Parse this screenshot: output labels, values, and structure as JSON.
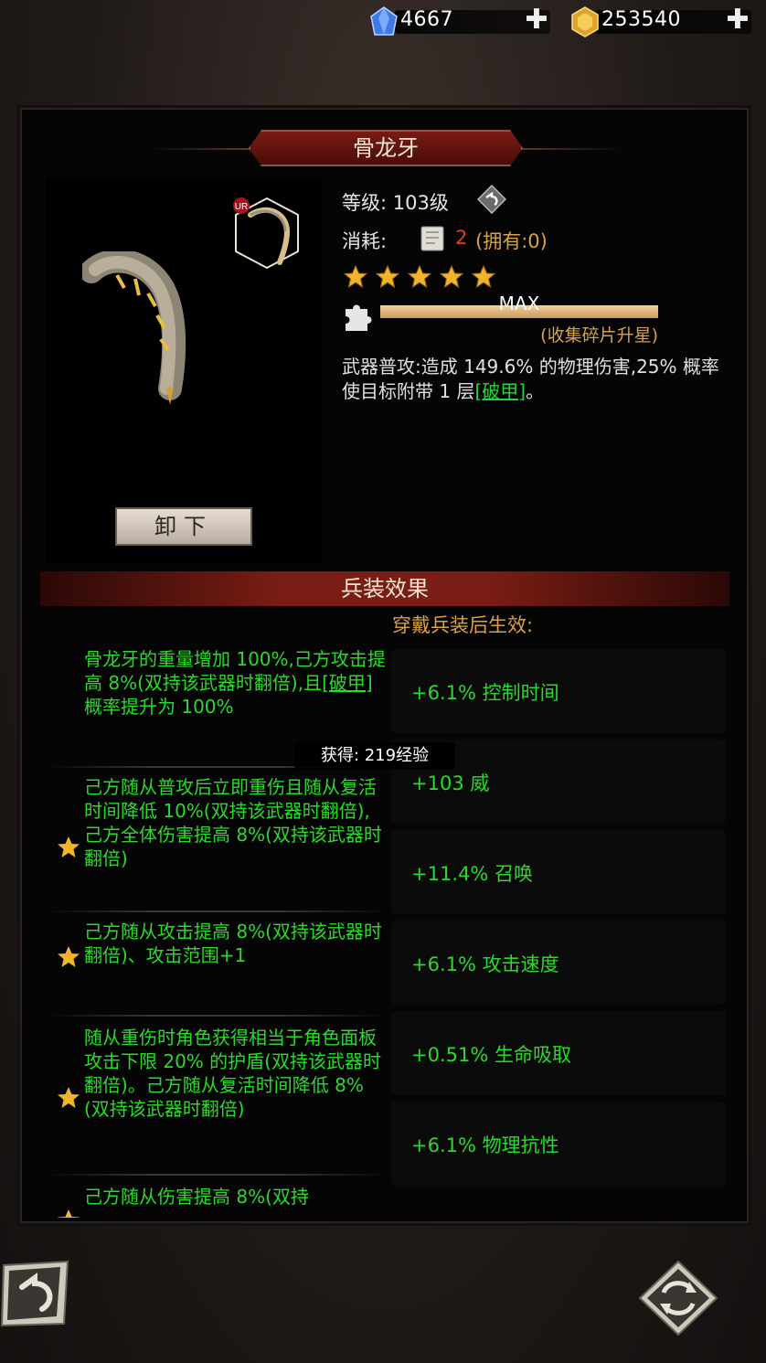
{
  "currency": {
    "gems": "4667",
    "gold": "253540",
    "plus": "✚"
  },
  "item": {
    "title": "骨龙牙",
    "rarity": "UR",
    "level_label": "等级:",
    "level_value": "103级",
    "cost_label": "消耗:",
    "cost_amount": "2",
    "cost_owned": "(拥有:0)",
    "stars": 5,
    "progress_fraction": 1.0,
    "progress_label": "MAX",
    "fragment_note": "(收集碎片升星)",
    "desc_prefix": "武器普攻:造成 149.6% 的物理伤害,25% 概率使目标附带 1 层",
    "desc_tag": "[破甲]",
    "desc_suffix": "。",
    "unequip_label": "卸下"
  },
  "effects_section": {
    "title": "兵装效果",
    "subtitle": "穿戴兵装后生效:",
    "effects": [
      {
        "text_a": "骨龙牙的重量增加 100%,己方攻击提高 8%(双持该武器时翻倍),且",
        "tag": "[破甲]",
        "text_b": "概率提升为 100%",
        "starred": false
      },
      {
        "text_a": "己方随从普攻后立即重伤且随从复活时间降低 10%(双持该武器时翻倍),己方全体伤害提高 8%(双持该武器时翻倍)",
        "starred": true
      },
      {
        "text_a": "己方随从攻击提高 8%(双持该武器时翻倍)、攻击范围+1",
        "starred": true
      },
      {
        "text_a": "随从重伤时角色获得相当于角色面板攻击下限 20% 的护盾(双持该武器时翻倍)。己方随从复活时间降低 8%(双持该武器时翻倍)",
        "starred": true
      },
      {
        "text_a": "己方随从伤害提高 8%(双持",
        "starred": true
      }
    ],
    "bonuses": [
      "+6.1% 控制时间",
      "+103 威",
      "+11.4% 召唤",
      "+6.1% 攻击速度",
      "+0.51% 生命吸取",
      "+6.1% 物理抗性"
    ]
  },
  "toast": "获得: 219经验",
  "icons": {
    "gem": "blue-gem-icon",
    "gold": "gold-ingot-icon",
    "back": "back-arrow-icon",
    "refresh": "refresh-icon",
    "puzzle": "puzzle-piece-icon",
    "scroll": "scroll-icon",
    "star": "star-icon"
  },
  "colors": {
    "effect_text": "#2bd92b",
    "accent_gold": "#d8a04a",
    "title_red": "#7a1b14"
  }
}
